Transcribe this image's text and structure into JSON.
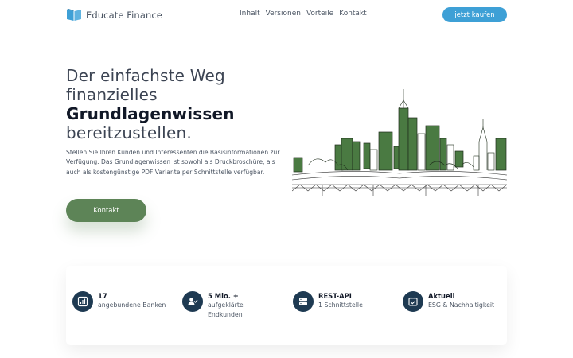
{
  "nav": {
    "brand_name": "Educate Finance",
    "menu": [
      "Inhalt",
      "Versionen",
      "Vorteile",
      "Kontakt"
    ],
    "buy_label": "jetzt kaufen"
  },
  "hero": {
    "title_line1": "Der einfachste Weg",
    "title_line2": "finanzielles",
    "title_bold": "Grundlagenwissen",
    "title_line4": "bereitzustellen.",
    "description": "Stellen Sie Ihren Kunden und Interessenten die Basisinformationen zur Verfügung. Das Grundlagenwissen ist sowohl als Druckbroschüre, als auch als kostengünstige PDF Variante per Schnittstelle verfügbar.",
    "contact_label": "Kontakt"
  },
  "stats": [
    {
      "value": "17",
      "label": "angebundene Banken",
      "icon": "chart-icon"
    },
    {
      "value": "5 Mio. +",
      "label": "aufgeklärte Endkunden",
      "icon": "user-check-icon"
    },
    {
      "value": "REST-API",
      "label": "1 Schnittstelle",
      "icon": "server-icon"
    },
    {
      "value": "Aktuell",
      "label": "ESG & Nachhaltigkeit",
      "icon": "calendar-check-icon"
    }
  ],
  "colors": {
    "accent_blue": "#3ea0d6",
    "button_green": "#5d8457",
    "icon_navy": "#1e3a52",
    "skyline_green": "#3f6b3a"
  }
}
